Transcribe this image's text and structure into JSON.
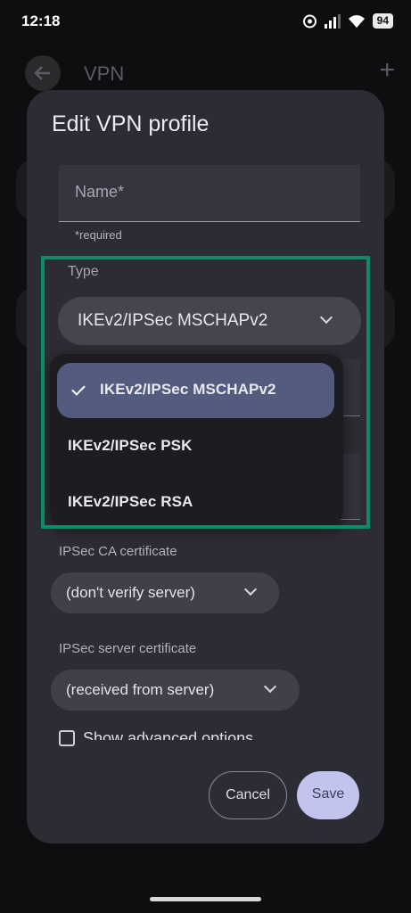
{
  "status_bar": {
    "time": "12:18",
    "battery": "94",
    "icons": [
      "alarm-icon",
      "signal-icon",
      "wifi-icon",
      "battery-icon"
    ]
  },
  "background": {
    "title": "VPN",
    "plus": "+"
  },
  "dialog": {
    "title": "Edit VPN profile",
    "name_placeholder": "Name*",
    "required_note": "*required",
    "type_label": "Type",
    "type_selected": "IKEv2/IPSec MSCHAPv2",
    "type_options": [
      {
        "label": "IKEv2/IPSec MSCHAPv2",
        "selected": true
      },
      {
        "label": "IKEv2/IPSec PSK",
        "selected": false
      },
      {
        "label": "IKEv2/IPSec RSA",
        "selected": false
      }
    ],
    "ca_cert_label": "IPSec CA certificate",
    "ca_cert_value": "(don't verify server)",
    "server_cert_label": "IPSec server certificate",
    "server_cert_value": "(received from server)",
    "advanced_label": "Show advanced options",
    "cancel_label": "Cancel",
    "save_label": "Save"
  },
  "colors": {
    "dialog_bg": "#2c2c34",
    "highlight": "#0d8a67",
    "selected_item": "#535c7e",
    "save_button": "#c3c4ee"
  }
}
